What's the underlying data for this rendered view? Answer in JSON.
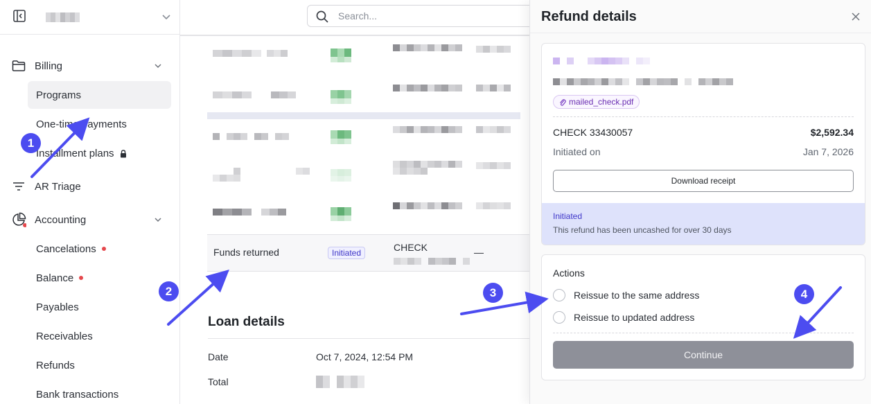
{
  "sidebar": {
    "sections": [
      {
        "label": "Billing",
        "icon": "folder-icon"
      },
      {
        "label": "AR Triage",
        "icon": "filter-lines-icon"
      },
      {
        "label": "Accounting",
        "icon": "pie-chart-icon"
      }
    ],
    "billing_items": [
      {
        "label": "Programs",
        "active": true
      },
      {
        "label": "One-time payments"
      },
      {
        "label": "Installment plans",
        "locked": true
      }
    ],
    "accounting_items": [
      {
        "label": "Cancelations",
        "alert": true
      },
      {
        "label": "Balance",
        "alert": true
      },
      {
        "label": "Payables"
      },
      {
        "label": "Receivables"
      },
      {
        "label": "Refunds"
      },
      {
        "label": "Bank transactions"
      }
    ]
  },
  "search": {
    "placeholder": "Search..."
  },
  "table": {
    "funds_row": {
      "label": "Funds returned",
      "status": "Initiated",
      "method": "CHECK",
      "dash": "—"
    }
  },
  "loan": {
    "title": "Loan details",
    "rows": [
      {
        "key": "Date",
        "value": "Oct 7, 2024, 12:54 PM"
      },
      {
        "key": "Total",
        "value": ""
      }
    ]
  },
  "refund_panel": {
    "title": "Refund details",
    "attachment": "mailed_check.pdf",
    "check_number": "CHECK 33430057",
    "amount": "$2,592.34",
    "initiated_label": "Initiated on",
    "initiated_date": "Jan 7, 2026",
    "download_label": "Download receipt",
    "status_title": "Initiated",
    "status_message": "This refund has been uncashed for over 30 days",
    "actions_title": "Actions",
    "options": [
      "Reissue to the same address",
      "Reissue to updated address"
    ],
    "continue_label": "Continue"
  },
  "annotations": [
    "1",
    "2",
    "3",
    "4"
  ],
  "colors": {
    "accent": "#4c4cf0",
    "status_bg": "#dee2fb",
    "alert_dot": "#e5484d",
    "button_disabled": "#8e9099"
  }
}
